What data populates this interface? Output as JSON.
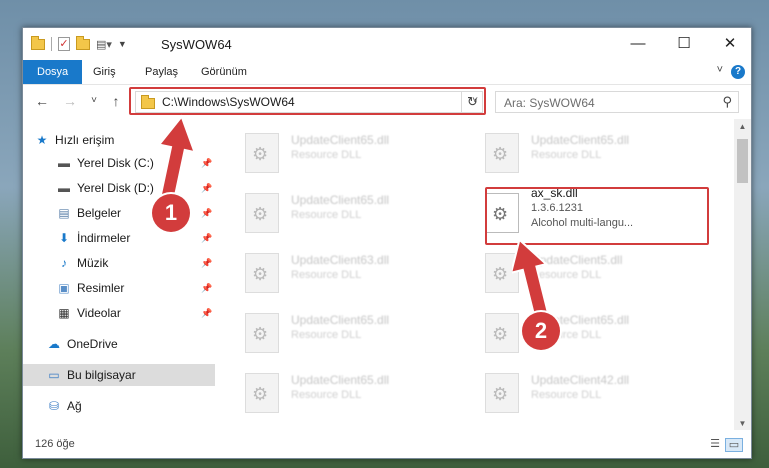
{
  "window": {
    "title": "SysWOW64",
    "controls": {
      "minimize": "—",
      "maximize": "☐",
      "close": "✕"
    }
  },
  "ribbon": {
    "tabs": [
      {
        "label": "Dosya"
      },
      {
        "label": "Giriş"
      },
      {
        "label": "Paylaş"
      },
      {
        "label": "Görünüm"
      }
    ],
    "help": "?"
  },
  "navigation": {
    "back": "←",
    "forward": "→",
    "recent": "˅",
    "up": "↑",
    "address": "C:\\Windows\\SysWOW64",
    "refresh": "↻",
    "search_placeholder": "Ara: SysWOW64"
  },
  "sidebar": {
    "items": [
      {
        "label": "Hızlı erişim",
        "icon": "star-icon"
      },
      {
        "label": "Yerel Disk (C:)",
        "icon": "drive-icon"
      },
      {
        "label": "Yerel Disk (D:)",
        "icon": "drive-icon"
      },
      {
        "label": "Belgeler",
        "icon": "documents-icon"
      },
      {
        "label": "İndirmeler",
        "icon": "downloads-icon"
      },
      {
        "label": "Müzik",
        "icon": "music-icon"
      },
      {
        "label": "Resimler",
        "icon": "pictures-icon"
      },
      {
        "label": "Videolar",
        "icon": "videos-icon"
      },
      {
        "label": "OneDrive",
        "icon": "cloud-icon"
      },
      {
        "label": "Bu bilgisayar",
        "icon": "computer-icon"
      },
      {
        "label": "Ağ",
        "icon": "network-icon"
      }
    ]
  },
  "files": [
    {
      "name": "UpdateClient65.dll",
      "type": "Resource DLL"
    },
    {
      "name": "UpdateClient65.dll",
      "type": "Resource DLL"
    },
    {
      "name": "UpdateClient65.dll",
      "type": "Resource DLL"
    },
    {
      "name": "ax_sk.dll",
      "version": "1.3.6.1231",
      "description": "Alcohol multi-langu..."
    },
    {
      "name": "UpdateClient63.dll",
      "type": "Resource DLL"
    },
    {
      "name": "UpdateClient5.dll",
      "type": "Resource DLL"
    },
    {
      "name": "UpdateClient65.dll",
      "type": "Resource DLL"
    },
    {
      "name": "UpdateClient65.dll",
      "type": "Resource DLL"
    },
    {
      "name": "UpdateClient65.dll",
      "type": "Resource DLL"
    },
    {
      "name": "UpdateClient42.dll",
      "type": "Resource DLL"
    }
  ],
  "annotations": {
    "step1": "1",
    "step2": "2"
  },
  "status": {
    "count": "126 öğe"
  },
  "colors": {
    "accent": "#1979ca",
    "highlight": "#d23c3c"
  }
}
